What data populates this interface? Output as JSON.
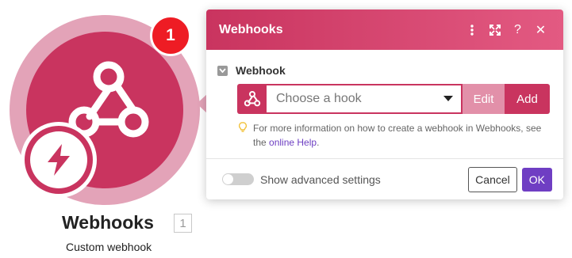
{
  "node": {
    "title": "Webhooks",
    "id": "1",
    "subtitle": "Custom webhook",
    "badge_count": "1",
    "icon": "webhook-icon",
    "trigger_icon": "lightning-icon",
    "color": "#c9345f"
  },
  "panel": {
    "title": "Webhooks",
    "header_icons": [
      "more-vertical-icon",
      "expand-icon",
      "help-icon",
      "close-icon"
    ],
    "help_glyph": "?",
    "close_glyph": "✕",
    "field_label": "Webhook",
    "select_placeholder": "Choose a hook",
    "edit_label": "Edit",
    "add_label": "Add",
    "hint_text": "For more information on how to create a webhook in Webhooks, see the",
    "hint_link": "online Help",
    "hint_end": ".",
    "advanced_label": "Show advanced settings",
    "advanced_enabled": false,
    "cancel_label": "Cancel",
    "ok_label": "OK",
    "accent": "#c9345f",
    "ok_color": "#6f3ec3"
  }
}
